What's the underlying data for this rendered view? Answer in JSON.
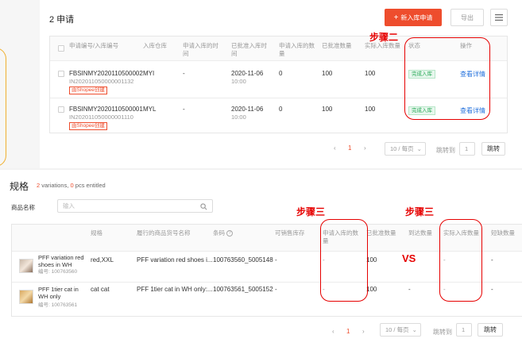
{
  "inbound": {
    "title": "2 申请",
    "new_button": "新入库申请",
    "export_button": "导出",
    "menu_icon": "menu-icon",
    "headers": [
      "申请编号/入库编号",
      "入库仓库",
      "申请入库的时间",
      "已批准入库时间",
      "申请入库的数量",
      "已批准数量",
      "实际入库数量",
      "状态",
      "操作"
    ],
    "rows": [
      {
        "id": "FBSINMY2020110500002",
        "inbound_no": "IN202011050000001132",
        "tag": "由Shopee创建",
        "warehouse": "MYI",
        "request_time": "-",
        "approved_date": "2020-11-06",
        "approved_time": "10:00",
        "req_qty": "0",
        "approved_qty": "100",
        "actual_qty": "100",
        "status": "完成入库",
        "action": "查看详情"
      },
      {
        "id": "FBSINMY2020110500001",
        "inbound_no": "IN202011050000001110",
        "tag": "由Shopee创建",
        "warehouse": "MYL",
        "request_time": "-",
        "approved_date": "2020-11-06",
        "approved_time": "10:00",
        "req_qty": "0",
        "approved_qty": "100",
        "actual_qty": "100",
        "status": "完成入库",
        "action": "查看详情"
      }
    ],
    "pagination": {
      "page": "1",
      "per_page": "10 / 每页",
      "goto_label": "跳转到",
      "goto_value": "1",
      "goto_button": "跳转"
    }
  },
  "annotations": {
    "step2": "步骤二",
    "step3a": "步骤三",
    "step3b": "步骤三",
    "vs": "VS",
    "color": "#e60000"
  },
  "specs": {
    "title": "规格",
    "variations_count": "2",
    "variations_label": " variations, ",
    "pcs_count": "0",
    "pcs_label": " pcs entitled",
    "name_label": "商品名称",
    "search_placeholder": "输入",
    "headers": [
      "规格",
      "履行的商品货号名称",
      "条码",
      "可销售库存",
      "申请入库的数量",
      "已批准数量",
      "到达数量",
      "实际入库数量",
      "短缺数量"
    ],
    "rows": [
      {
        "name": "PFF variation red shoes in WH",
        "sku": "编号: 100763560",
        "spec": "red,XXL",
        "fulfil_name": "PFF variation red shoes i...",
        "barcode": "100763560_5005148",
        "sellable": "-",
        "req_qty": "-",
        "approved_qty": "100",
        "arrived_qty": "-",
        "actual_qty": "-",
        "short_qty": "-"
      },
      {
        "name": "PFF 1tier cat in WH only",
        "sku": "编号: 100763561",
        "spec": "cat cat",
        "fulfil_name": "PFF 1tier cat in WH only:...",
        "barcode": "100763561_5005152",
        "sellable": "-",
        "req_qty": "-",
        "approved_qty": "100",
        "arrived_qty": "-",
        "actual_qty": "-",
        "short_qty": "-"
      }
    ],
    "pagination": {
      "page": "1",
      "per_page": "10 / 每页",
      "goto_label": "跳转到",
      "goto_value": "1",
      "goto_button": "跳转"
    }
  },
  "colors": {
    "brand": "#ee4d2d",
    "link": "#2673dd",
    "success": "#26aa55"
  }
}
